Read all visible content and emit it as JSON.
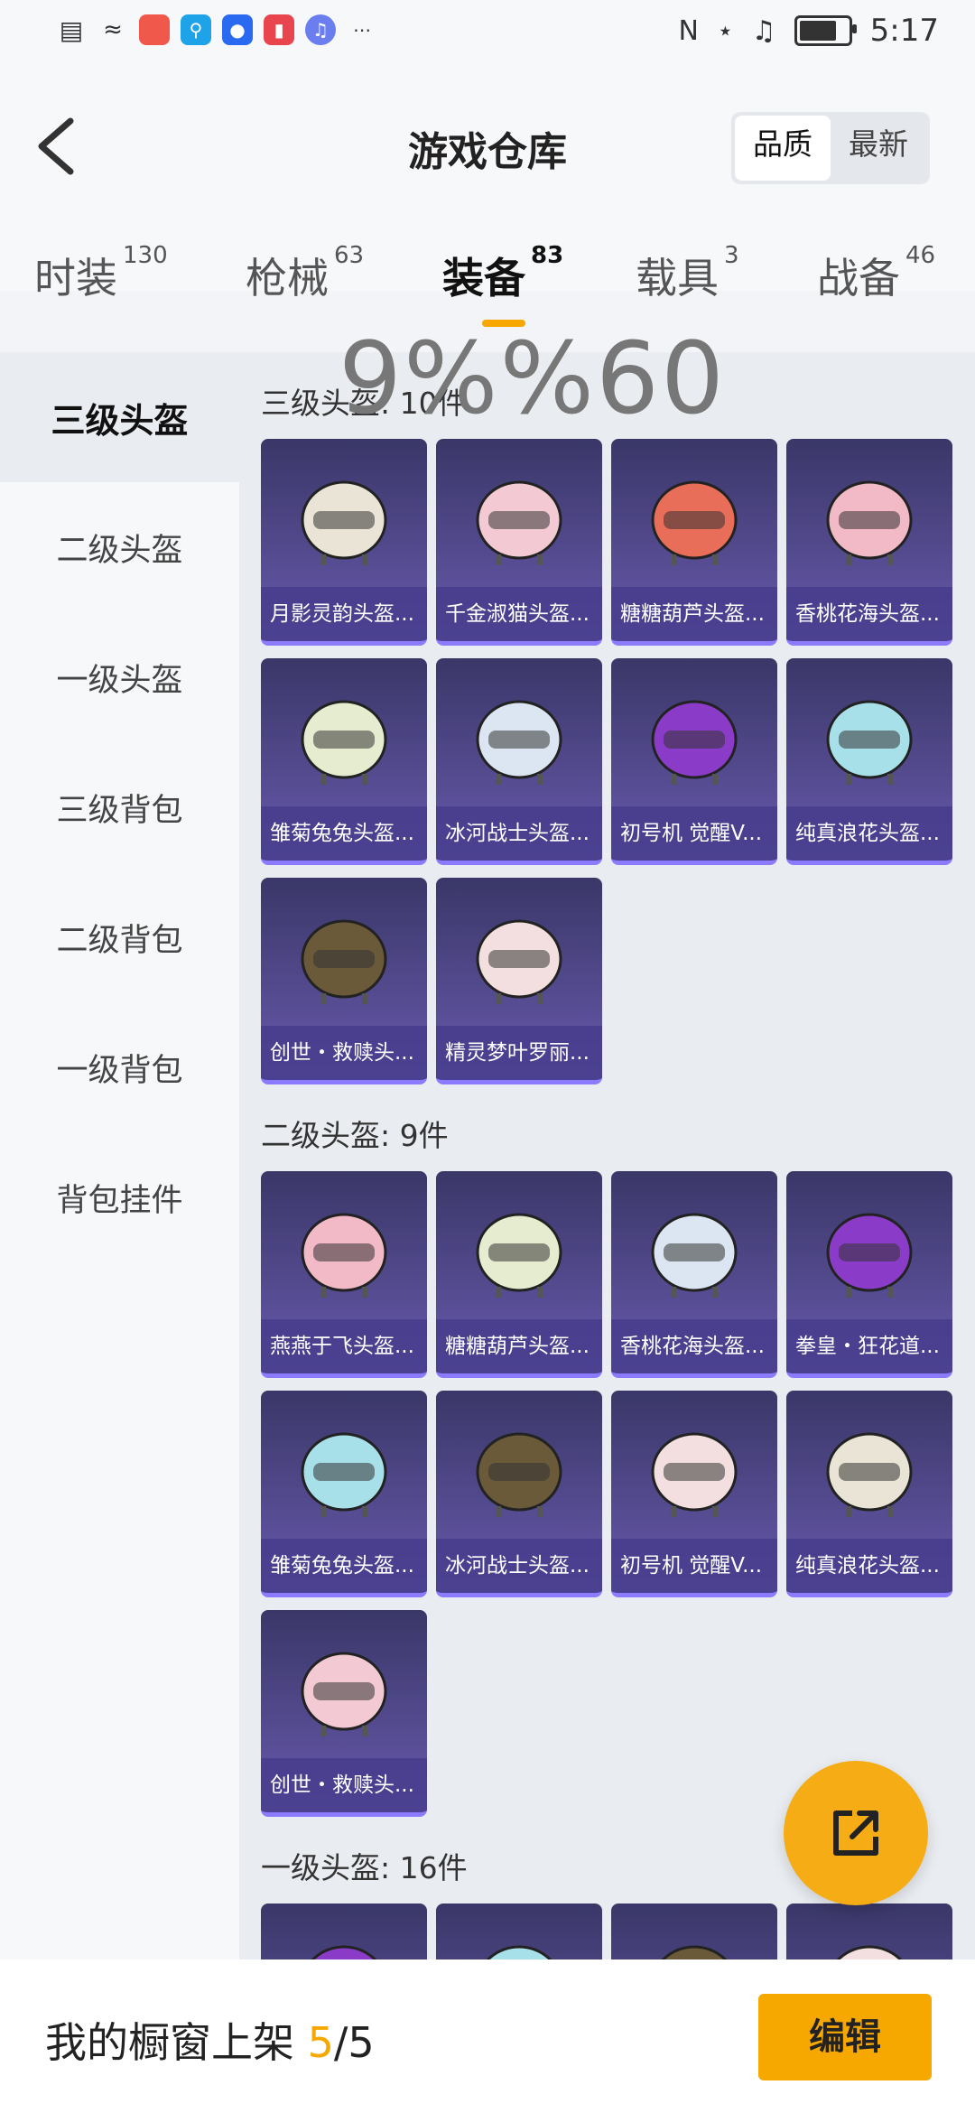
{
  "status_bar": {
    "time": "5:17",
    "icons": [
      "alert-icon",
      "wifi-icon",
      "app-red-icon",
      "search-app-icon",
      "bulb-icon",
      "book-icon",
      "music-icon",
      "more-icon"
    ],
    "right_icons": [
      "nfc-icon",
      "bluetooth-icon",
      "mute-icon",
      "battery-icon"
    ]
  },
  "header": {
    "title": "游戏仓库",
    "sort_options": [
      "品质",
      "最新"
    ]
  },
  "tabs": [
    {
      "label": "时装",
      "count": "130"
    },
    {
      "label": "枪械",
      "count": "63"
    },
    {
      "label": "装备",
      "count": "83"
    },
    {
      "label": "载具",
      "count": "3"
    },
    {
      "label": "战备",
      "count": "46"
    }
  ],
  "sidebar": {
    "items": [
      "三级头盔",
      "二级头盔",
      "一级头盔",
      "三级背包",
      "二级背包",
      "一级背包",
      "背包挂件"
    ]
  },
  "overlay_text": "9%%60",
  "sections": [
    {
      "title": "三级头盔: 10件",
      "items": [
        "月影灵韵头盔...",
        "千金淑猫头盔...",
        "糖糖葫芦头盔...",
        "香桃花海头盔...",
        "雏菊兔兔头盔...",
        "冰河战士头盔...",
        "初号机 觉醒V...",
        "纯真浪花头盔...",
        "创世・救赎头...",
        "精灵梦叶罗丽..."
      ]
    },
    {
      "title": "二级头盔: 9件",
      "items": [
        "燕燕于飞头盔...",
        "糖糖葫芦头盔...",
        "香桃花海头盔...",
        "拳皇・狂花道...",
        "雏菊兔兔头盔...",
        "冰河战士头盔...",
        "初号机 觉醒V...",
        "纯真浪花头盔...",
        "创世・救赎头..."
      ]
    },
    {
      "title": "一级头盔: 16件",
      "items": [
        "",
        "",
        "",
        ""
      ]
    }
  ],
  "bottom": {
    "shelf_label": "我的橱窗上架",
    "shelf_current": "5",
    "shelf_total": "/5",
    "edit_label": "编辑"
  },
  "colors": {
    "accent": "#f6a800",
    "card": "#4a4480"
  }
}
